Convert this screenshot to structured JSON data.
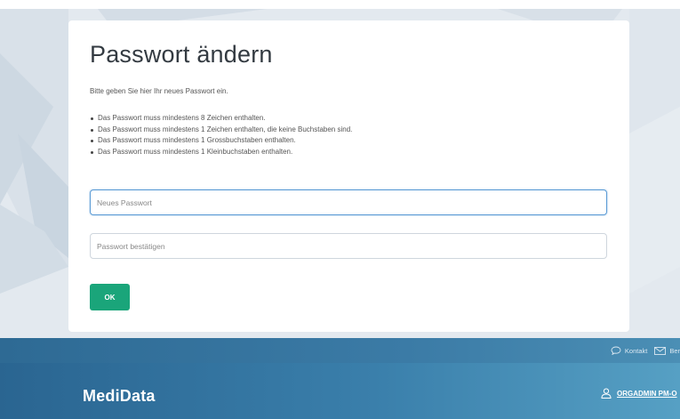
{
  "form": {
    "title": "Passwort ändern",
    "intro": "Bitte geben Sie hier Ihr neues Passwort ein.",
    "rules": [
      "Das Passwort muss mindestens 8 Zeichen enthalten.",
      "Das Passwort muss mindestens 1 Zeichen enthalten, die keine Buchstaben sind.",
      "Das Passwort muss mindestens 1 Grossbuchstaben enthalten.",
      "Das Passwort muss mindestens 1 Kleinbuchstaben enthalten."
    ],
    "new_password": {
      "value": "",
      "placeholder": "Neues Passwort"
    },
    "confirm_password": {
      "value": "",
      "placeholder": "Passwort bestätigen"
    },
    "ok_label": "OK"
  },
  "footer": {
    "links": [
      {
        "label": "Kontakt",
        "icon": "chat-bubble-icon"
      },
      {
        "label": "Ber",
        "icon": "mail-icon"
      }
    ],
    "brand": "MediData",
    "user": {
      "label": "ORGADMIN PM-O",
      "icon": "user-icon"
    }
  },
  "colors": {
    "primary_button": "#1aa57a",
    "focus_border": "#5b9bd5",
    "footer_blue": "#2e6a94"
  }
}
